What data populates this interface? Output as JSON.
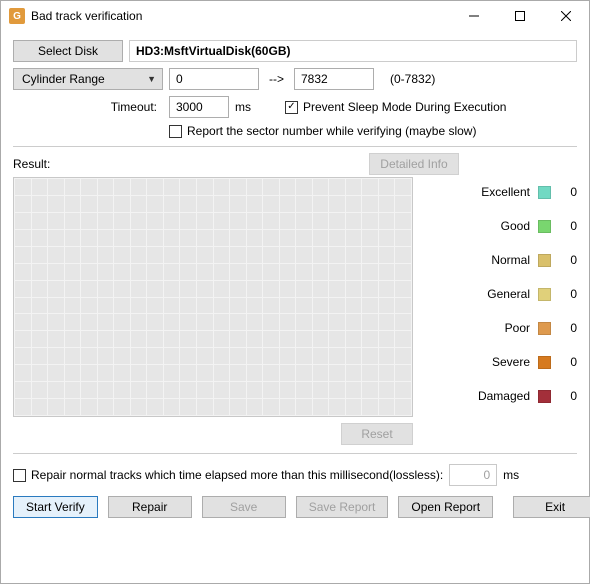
{
  "window": {
    "title": "Bad track verification"
  },
  "toolbar": {
    "select_disk": "Select Disk",
    "disk_name": "HD3:MsftVirtualDisk(60GB)"
  },
  "range": {
    "mode": "Cylinder Range",
    "start": "0",
    "end": "7832",
    "hint": "(0-7832)",
    "arrow": "-->"
  },
  "timeout": {
    "label": "Timeout:",
    "value": "3000",
    "unit": "ms"
  },
  "options": {
    "prevent_sleep": "Prevent Sleep Mode During Execution",
    "report_sector": "Report the sector number while verifying (maybe slow)"
  },
  "result": {
    "label": "Result:",
    "detailed_btn": "Detailed Info",
    "reset_btn": "Reset"
  },
  "legend": {
    "items": [
      {
        "label": "Excellent",
        "color": "#71d9c3",
        "count": "0"
      },
      {
        "label": "Good",
        "color": "#79d66f",
        "count": "0"
      },
      {
        "label": "Normal",
        "color": "#d9c06b",
        "count": "0"
      },
      {
        "label": "General",
        "color": "#e0d07a",
        "count": "0"
      },
      {
        "label": "Poor",
        "color": "#de9a4e",
        "count": "0"
      },
      {
        "label": "Severe",
        "color": "#d67a1f",
        "count": "0"
      },
      {
        "label": "Damaged",
        "color": "#a32f3a",
        "count": "0"
      }
    ]
  },
  "repair": {
    "checkbox_label": "Repair normal tracks which time elapsed more than this millisecond(lossless):",
    "value": "0",
    "unit": "ms"
  },
  "buttons": {
    "start_verify": "Start Verify",
    "repair": "Repair",
    "save": "Save",
    "save_report": "Save Report",
    "open_report": "Open Report",
    "exit": "Exit"
  }
}
